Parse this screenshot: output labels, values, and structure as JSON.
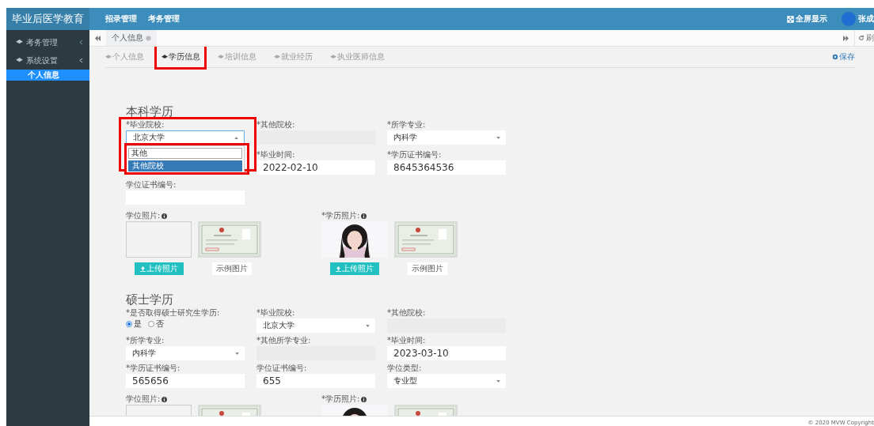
{
  "header": {
    "logo": "毕业后医学教育",
    "nav": [
      "招录管理",
      "考务管理"
    ],
    "fullscreen": "全屏显示",
    "user": "张成"
  },
  "sidebar": {
    "items": [
      {
        "label": "考务管理",
        "expanded": false
      },
      {
        "label": "系统设置",
        "expanded": true,
        "children": [
          {
            "label": "个人信息",
            "selected": true
          }
        ]
      }
    ]
  },
  "page_tabs": [
    {
      "label": "个人信息",
      "selected": true
    }
  ],
  "refresh": "刷",
  "sub_tabs": [
    {
      "label": "个人信息",
      "selected": false,
      "highlighted": false
    },
    {
      "label": "学历信息",
      "selected": true,
      "highlighted": true
    },
    {
      "label": "培训信息",
      "selected": false,
      "highlighted": false
    },
    {
      "label": "就业经历",
      "selected": false,
      "highlighted": false
    },
    {
      "label": "执业医师信息",
      "selected": false,
      "highlighted": false
    }
  ],
  "save": "保存",
  "sections": [
    {
      "title": "本科学历",
      "fields": [
        {
          "kind": "select",
          "label": "*毕业院校:",
          "value": "北京大学",
          "highlighted": true,
          "dropdown": {
            "search": "其他",
            "highlighted": true,
            "options": [
              {
                "label": "其他院校",
                "selected": true
              }
            ]
          }
        },
        {
          "kind": "disabled",
          "label": "*其他院校:"
        },
        {
          "kind": "select",
          "label": "*所学专业:",
          "value": "内科学"
        },
        {
          "kind": "blank"
        },
        {
          "kind": "input",
          "label": "*毕业时间:",
          "value": "2022-02-10"
        },
        {
          "kind": "input",
          "label": "*学历证书编号:",
          "value": "8645364536"
        },
        {
          "kind": "input",
          "label": "学位证书编号:"
        }
      ],
      "photos": [
        {
          "label": "学位照片:",
          "uploaded": false,
          "upload": "上传照片",
          "sample": "示例图片"
        },
        {
          "label": "*学历照片:",
          "uploaded": true,
          "upload": "上传照片",
          "sample": "示例图片"
        }
      ]
    },
    {
      "title": "硕士学历",
      "fields": [
        {
          "kind": "radio",
          "label": "*是否取得硕士研究生学历:",
          "options": [
            {
              "label": "是",
              "selected": true
            },
            {
              "label": "否",
              "selected": false
            }
          ]
        },
        {
          "kind": "select",
          "label": "*毕业院校:",
          "value": "北京大学"
        },
        {
          "kind": "disabled",
          "label": "*其他院校:"
        },
        {
          "kind": "select",
          "label": "*所学专业:",
          "value": "内科学"
        },
        {
          "kind": "disabled",
          "label": "*其他所学专业:"
        },
        {
          "kind": "input",
          "label": "*毕业时间:",
          "value": "2023-03-10"
        },
        {
          "kind": "input",
          "label": "*学历证书编号:",
          "value": "565656"
        },
        {
          "kind": "input",
          "label": "学位证书编号:",
          "value": "655"
        },
        {
          "kind": "select",
          "label": "学位类型:",
          "value": "专业型"
        }
      ],
      "photos": [
        {
          "label": "学位照片:",
          "uploaded": false
        },
        {
          "label": "*学历照片:",
          "uploaded": true
        }
      ]
    }
  ],
  "footer": "© 2020 MVW Copyright"
}
